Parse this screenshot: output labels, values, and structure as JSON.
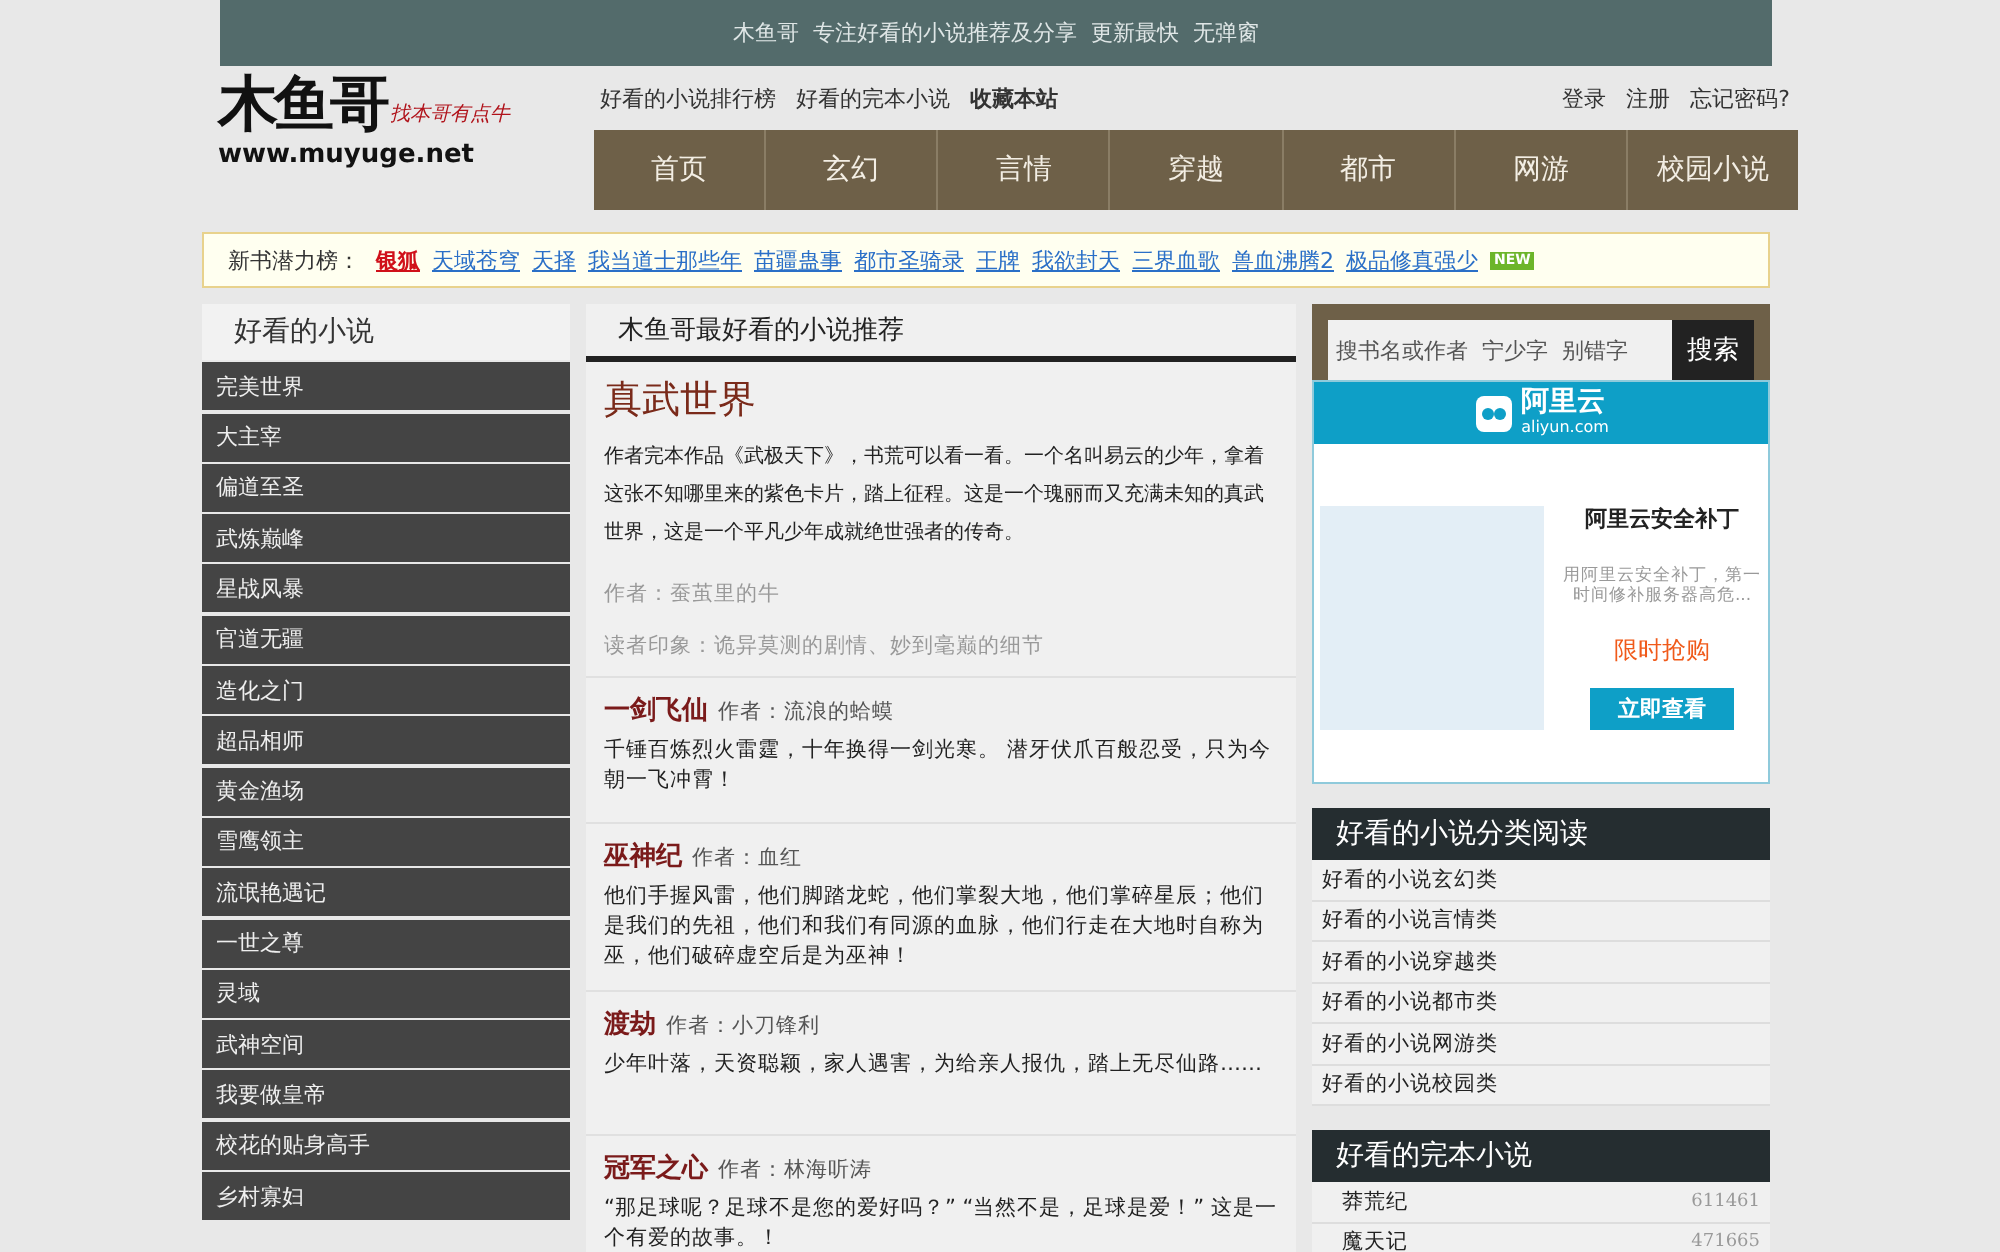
{
  "top_bar": {
    "text": "木鱼哥  专注好看的小说推荐及分享  更新最快  无弹窗"
  },
  "logo": {
    "name": "木鱼哥",
    "slogan": "找本哥有点牛",
    "url": "www.muyuge.net"
  },
  "header_links": [
    {
      "label": "好看的小说排行榜",
      "bold": false
    },
    {
      "label": "好看的完本小说",
      "bold": false
    },
    {
      "label": "收藏本站",
      "bold": true
    }
  ],
  "account_links": [
    "登录",
    "注册",
    "忘记密码?"
  ],
  "nav": [
    {
      "label": "首页"
    },
    {
      "label": "玄幻"
    },
    {
      "label": "言情"
    },
    {
      "label": "穿越"
    },
    {
      "label": "都市"
    },
    {
      "label": "网游"
    },
    {
      "label": "校园小说"
    }
  ],
  "new_books": {
    "label": "新书潜力榜：",
    "badge": "NEW",
    "items": [
      {
        "title": "银狐",
        "hot": true
      },
      {
        "title": "天域苍穹",
        "hot": false
      },
      {
        "title": "天择",
        "hot": false
      },
      {
        "title": "我当道士那些年",
        "hot": false
      },
      {
        "title": "苗疆蛊事",
        "hot": false
      },
      {
        "title": "都市圣骑录",
        "hot": false
      },
      {
        "title": "王牌",
        "hot": false
      },
      {
        "title": "我欲封天",
        "hot": false
      },
      {
        "title": "三界血歌",
        "hot": false
      },
      {
        "title": "兽血沸腾2",
        "hot": false
      },
      {
        "title": "极品修真强少",
        "hot": false
      }
    ]
  },
  "sidebar": {
    "title": "好看的小说",
    "items": [
      "完美世界",
      "大主宰",
      "偏道至圣",
      "武炼巅峰",
      "星战风暴",
      "官道无疆",
      "造化之门",
      "超品相师",
      "黄金渔场",
      "雪鹰领主",
      "流氓艳遇记",
      "一世之尊",
      "灵域",
      "武神空间",
      "我要做皇帝",
      "校花的贴身高手",
      "乡村寡妇"
    ]
  },
  "main": {
    "title": "木鱼哥最好看的小说推荐",
    "featured": {
      "title": "真武世界",
      "description": "作者完本作品《武极天下》，书荒可以看一看。一个名叫易云的少年，拿着这张不知哪里来的紫色卡片，踏上征程。这是一个瑰丽而又充满未知的真武世界，这是一个平凡少年成就绝世强者的传奇。",
      "author": "作者：蚕茧里的牛",
      "impression": "读者印象：诡异莫测的剧情、妙到毫巅的细节"
    },
    "books": [
      {
        "title": "一剑飞仙",
        "author": "作者：流浪的蛤蟆",
        "summary": "千锤百炼烈火雷霆，十年换得一剑光寒。 潜牙伏爪百般忍受，只为今朝一飞冲霄！"
      },
      {
        "title": "巫神纪",
        "author": "作者：血红",
        "summary": "他们手握风雷，他们脚踏龙蛇，他们掌裂大地，他们掌碎星辰；他们是我们的先祖，他们和我们有同源的血脉，他们行走在大地时自称为巫，他们破碎虚空后是为巫神！"
      },
      {
        "title": "渡劫",
        "author": "作者：小刀锋利",
        "summary": "少年叶落，天资聪颖，家人遇害，为给亲人报仇，踏上无尽仙路……"
      },
      {
        "title": "冠军之心",
        "author": "作者：林海听涛",
        "summary": "“那足球呢？足球不是您的爱好吗？” “当然不是，足球是爱！” 这是一个有爱的故事。！"
      }
    ]
  },
  "search": {
    "placeholder": "搜书名或作者  宁少字  别错字",
    "button": "搜索"
  },
  "ad": {
    "brand": "阿里云",
    "domain": "aliyun.com",
    "title": "阿里云安全补丁",
    "text_1": "用阿里云安全补丁，第一",
    "text_2": "时间修补服务器高危...",
    "promo": "限时抢购",
    "button": "立即查看"
  },
  "categories": {
    "title": "好看的小说分类阅读",
    "items": [
      "好看的小说玄幻类",
      "好看的小说言情类",
      "好看的小说穿越类",
      "好看的小说都市类",
      "好看的小说网游类",
      "好看的小说校园类"
    ]
  },
  "completed": {
    "title": "好看的完本小说",
    "items": [
      {
        "title": "莽荒纪",
        "count": "611461"
      },
      {
        "title": "魔天记",
        "count": "471665"
      }
    ]
  }
}
